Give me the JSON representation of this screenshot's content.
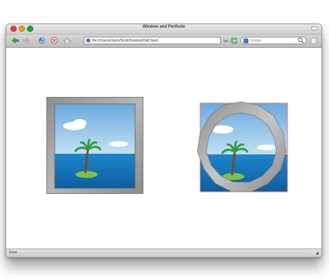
{
  "window": {
    "title": "Window and Porthole",
    "traffic_light_colors": [
      "#e0443e",
      "#dea123",
      "#1aab29"
    ]
  },
  "toolbar": {
    "back_icon": "back-arrow-icon",
    "forward_icon": "forward-arrow-icon",
    "reload_icon": "reload-icon",
    "home_icon": "home-icon",
    "url": "file:///Users/Users/Scott/Desktop/Hall Start/",
    "search_placeholder": "Google"
  },
  "content": {
    "left_image": "square-window-frame-with-island",
    "right_image": "round-porthole-frame-with-island",
    "sky_color": "#bfe3f7",
    "sea_color": "#1a78c2",
    "frame_color": "#9a9a9a"
  },
  "status": {
    "text": "Done"
  }
}
